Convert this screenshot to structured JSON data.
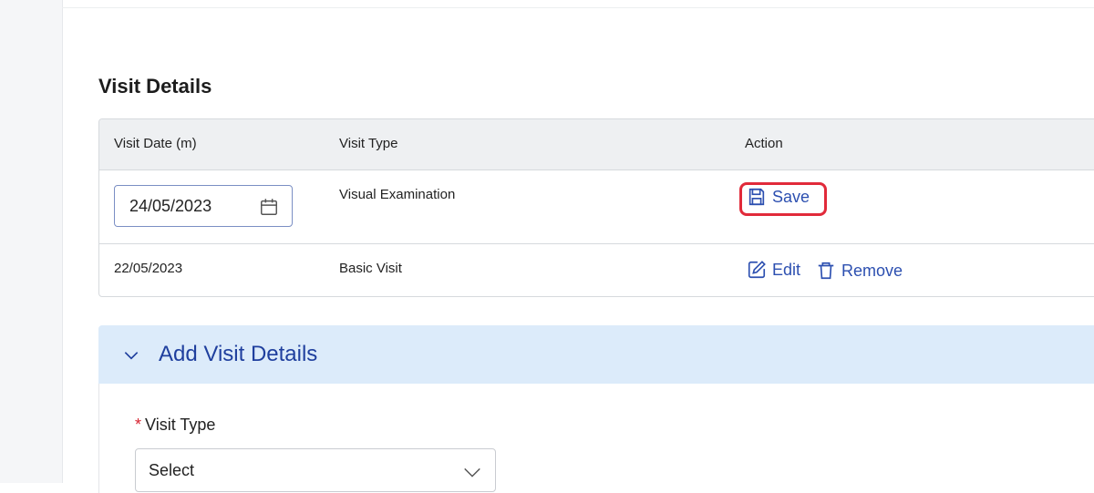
{
  "section": {
    "title": "Visit Details"
  },
  "table": {
    "columns": [
      "Visit Date (m)",
      "Visit Type",
      "Action"
    ],
    "rows": [
      {
        "date": "24/05/2023",
        "type": "Visual Examination",
        "actions": [
          "Save"
        ]
      },
      {
        "date": "22/05/2023",
        "type": "Basic Visit",
        "actions": [
          "Edit",
          "Remove"
        ]
      }
    ]
  },
  "accordion": {
    "title": "Add Visit Details",
    "field_label": "Visit Type",
    "required_mark": "*",
    "select_value": "Select"
  },
  "colors": {
    "link": "#2c4fb0",
    "highlight": "#e12a3a",
    "accordion_bg": "#dcebfa"
  },
  "icons": {
    "date": "calendar-icon",
    "save": "save-icon",
    "edit": "edit-icon",
    "remove": "trash-icon",
    "accordion": "chevron-down-icon",
    "select": "chevron-down-icon"
  }
}
